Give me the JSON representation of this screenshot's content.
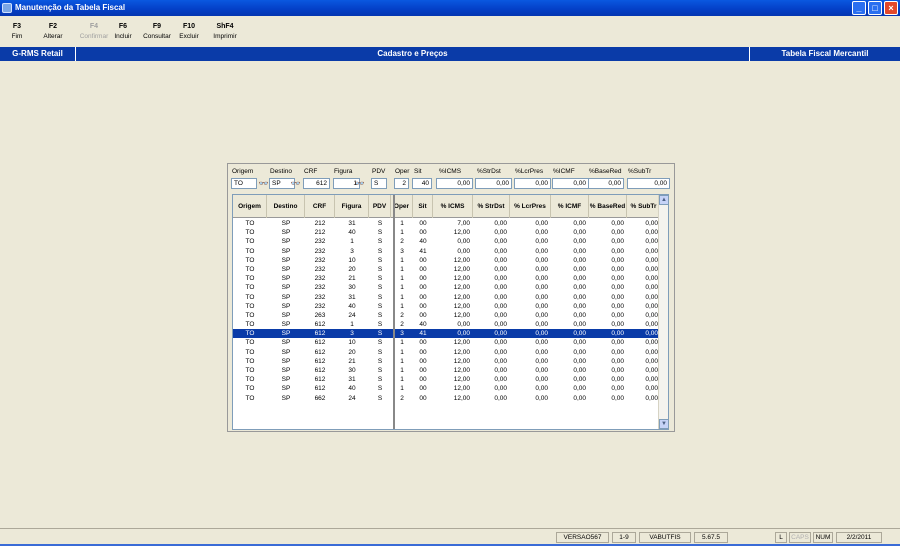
{
  "window": {
    "title": "Manutenção da Tabela Fiscal",
    "controls": [
      "_",
      "□",
      "×"
    ]
  },
  "toolbar": [
    {
      "key": "F3",
      "label": "Fim",
      "enabled": true
    },
    {
      "key": "F2",
      "label": "Alterar",
      "enabled": true
    },
    {
      "key": "F4",
      "label": "Confirmar",
      "enabled": false
    },
    {
      "key": "F6",
      "label": "Incluir",
      "enabled": true
    },
    {
      "key": "F9",
      "label": "Consultar",
      "enabled": true
    },
    {
      "key": "F10",
      "label": "Excluir",
      "enabled": true
    },
    {
      "key": "ShF4",
      "label": "Imprimir",
      "enabled": true
    }
  ],
  "navbar": {
    "left": "G-RMS Retail",
    "center": "Cadastro e Preços",
    "right": "Tabela Fiscal Mercantil"
  },
  "filters": [
    {
      "label": "Origem",
      "value": "TO"
    },
    {
      "label": "Destino",
      "value": "SP"
    },
    {
      "label": "CRF",
      "value": "612"
    },
    {
      "label": "Figura",
      "value": "1"
    },
    {
      "label": "PDV",
      "value": "S"
    },
    {
      "label": "Oper",
      "value": "2"
    },
    {
      "label": "Sit",
      "value": "40"
    },
    {
      "label": "%ICMS",
      "value": "0,00"
    },
    {
      "label": "%StrDst",
      "value": "0,00"
    },
    {
      "label": "%LcrPres",
      "value": "0,00"
    },
    {
      "label": "%ICMF",
      "value": "0,00"
    },
    {
      "label": "%BaseRed",
      "value": "0,00"
    },
    {
      "label": "%SubTr",
      "value": "0,00"
    }
  ],
  "grid": {
    "columns": [
      "Origem",
      "Destino",
      "CRF",
      "Figura",
      "PDV",
      "Oper",
      "Sit",
      "% ICMS",
      "% StrDst",
      "% LcrPres",
      "% ICMF",
      "% BaseRed",
      "% SubTr"
    ],
    "selected_index": 12,
    "rows": [
      [
        "TO",
        "SP",
        "212",
        "31",
        "S",
        "1",
        "00",
        "7,00",
        "0,00",
        "0,00",
        "0,00",
        "0,00",
        "0,00"
      ],
      [
        "TO",
        "SP",
        "212",
        "40",
        "S",
        "1",
        "00",
        "12,00",
        "0,00",
        "0,00",
        "0,00",
        "0,00",
        "0,00"
      ],
      [
        "TO",
        "SP",
        "232",
        "1",
        "S",
        "2",
        "40",
        "0,00",
        "0,00",
        "0,00",
        "0,00",
        "0,00",
        "0,00"
      ],
      [
        "TO",
        "SP",
        "232",
        "3",
        "S",
        "3",
        "41",
        "0,00",
        "0,00",
        "0,00",
        "0,00",
        "0,00",
        "0,00"
      ],
      [
        "TO",
        "SP",
        "232",
        "10",
        "S",
        "1",
        "00",
        "12,00",
        "0,00",
        "0,00",
        "0,00",
        "0,00",
        "0,00"
      ],
      [
        "TO",
        "SP",
        "232",
        "20",
        "S",
        "1",
        "00",
        "12,00",
        "0,00",
        "0,00",
        "0,00",
        "0,00",
        "0,00"
      ],
      [
        "TO",
        "SP",
        "232",
        "21",
        "S",
        "1",
        "00",
        "12,00",
        "0,00",
        "0,00",
        "0,00",
        "0,00",
        "0,00"
      ],
      [
        "TO",
        "SP",
        "232",
        "30",
        "S",
        "1",
        "00",
        "12,00",
        "0,00",
        "0,00",
        "0,00",
        "0,00",
        "0,00"
      ],
      [
        "TO",
        "SP",
        "232",
        "31",
        "S",
        "1",
        "00",
        "12,00",
        "0,00",
        "0,00",
        "0,00",
        "0,00",
        "0,00"
      ],
      [
        "TO",
        "SP",
        "232",
        "40",
        "S",
        "1",
        "00",
        "12,00",
        "0,00",
        "0,00",
        "0,00",
        "0,00",
        "0,00"
      ],
      [
        "TO",
        "SP",
        "263",
        "24",
        "S",
        "2",
        "00",
        "12,00",
        "0,00",
        "0,00",
        "0,00",
        "0,00",
        "0,00"
      ],
      [
        "TO",
        "SP",
        "612",
        "1",
        "S",
        "2",
        "40",
        "0,00",
        "0,00",
        "0,00",
        "0,00",
        "0,00",
        "0,00"
      ],
      [
        "TO",
        "SP",
        "612",
        "3",
        "S",
        "3",
        "41",
        "0,00",
        "0,00",
        "0,00",
        "0,00",
        "0,00",
        "0,00"
      ],
      [
        "TO",
        "SP",
        "612",
        "10",
        "S",
        "1",
        "00",
        "12,00",
        "0,00",
        "0,00",
        "0,00",
        "0,00",
        "0,00"
      ],
      [
        "TO",
        "SP",
        "612",
        "20",
        "S",
        "1",
        "00",
        "12,00",
        "0,00",
        "0,00",
        "0,00",
        "0,00",
        "0,00"
      ],
      [
        "TO",
        "SP",
        "612",
        "21",
        "S",
        "1",
        "00",
        "12,00",
        "0,00",
        "0,00",
        "0,00",
        "0,00",
        "0,00"
      ],
      [
        "TO",
        "SP",
        "612",
        "30",
        "S",
        "1",
        "00",
        "12,00",
        "0,00",
        "0,00",
        "0,00",
        "0,00",
        "0,00"
      ],
      [
        "TO",
        "SP",
        "612",
        "31",
        "S",
        "1",
        "00",
        "12,00",
        "0,00",
        "0,00",
        "0,00",
        "0,00",
        "0,00"
      ],
      [
        "TO",
        "SP",
        "612",
        "40",
        "S",
        "1",
        "00",
        "12,00",
        "0,00",
        "0,00",
        "0,00",
        "0,00",
        "0,00"
      ],
      [
        "TO",
        "SP",
        "662",
        "24",
        "S",
        "2",
        "00",
        "12,00",
        "0,00",
        "0,00",
        "0,00",
        "0,00",
        "0,00"
      ]
    ]
  },
  "statusbar": {
    "version": "VERSAO567",
    "page": "1-9",
    "user": "VABUTFIS",
    "build": "5.67.5",
    "lock": "L",
    "caps": "CAPS",
    "num": "NUM",
    "date": "2/2/2011"
  }
}
